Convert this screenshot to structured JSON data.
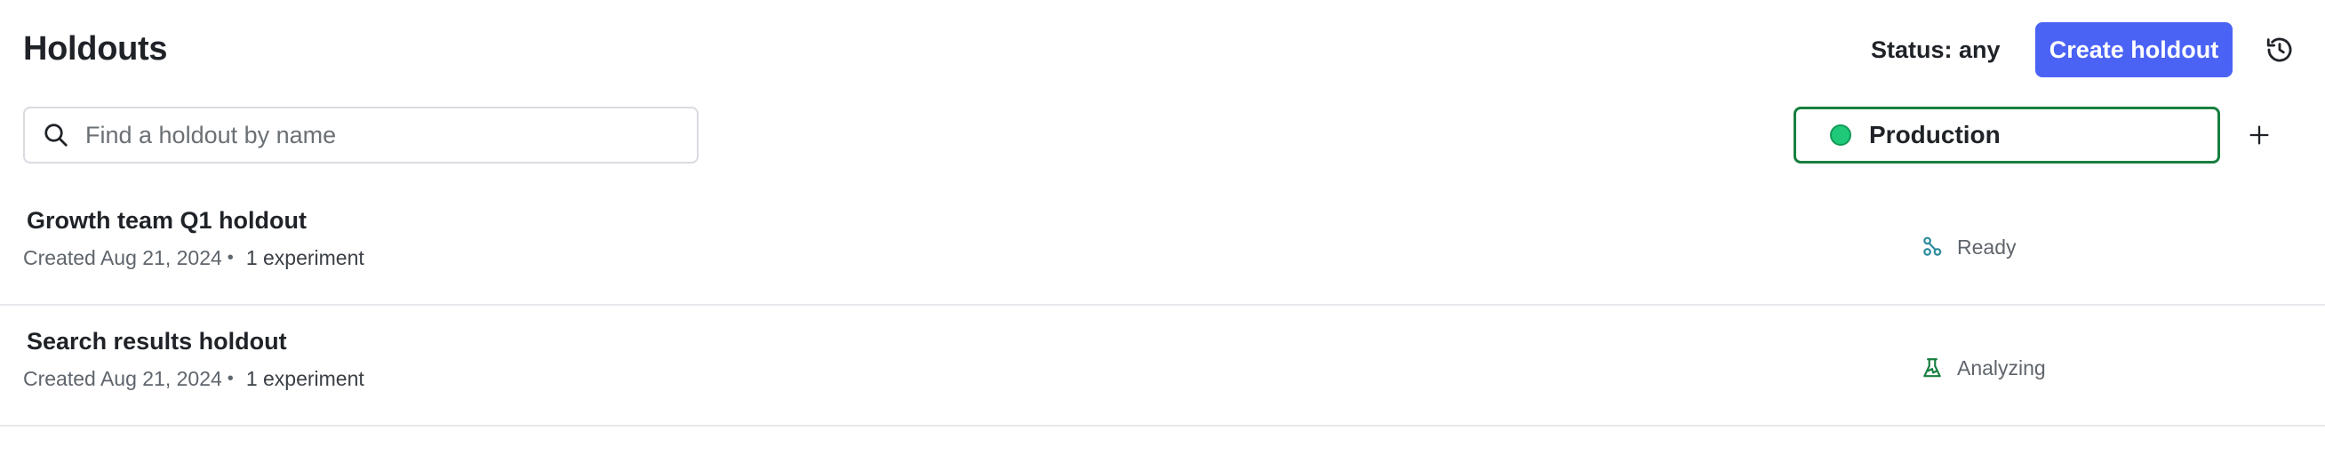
{
  "header": {
    "title": "Holdouts",
    "status_filter": "Status: any",
    "create_button": "Create holdout",
    "history_icon": "history-icon"
  },
  "search": {
    "placeholder": "Find a holdout by name",
    "value": "",
    "icon": "search-icon"
  },
  "environment": {
    "label": "Production",
    "dot_color": "#1fc978",
    "border_color": "#177f3f",
    "add_icon": "plus-icon"
  },
  "colors": {
    "accent": "#4a63f5",
    "ready": "#2b8a9e",
    "analyzing": "#177f3f"
  },
  "holdouts": [
    {
      "name": "Growth team Q1 holdout",
      "created": "Created Aug 21, 2024",
      "separator": "•",
      "experiments": "1 experiment",
      "status": "Ready",
      "status_icon": "ready-icon"
    },
    {
      "name": "Search results holdout",
      "created": "Created Aug 21, 2024",
      "separator": "•",
      "experiments": "1 experiment",
      "status": "Analyzing",
      "status_icon": "flask-icon"
    }
  ]
}
